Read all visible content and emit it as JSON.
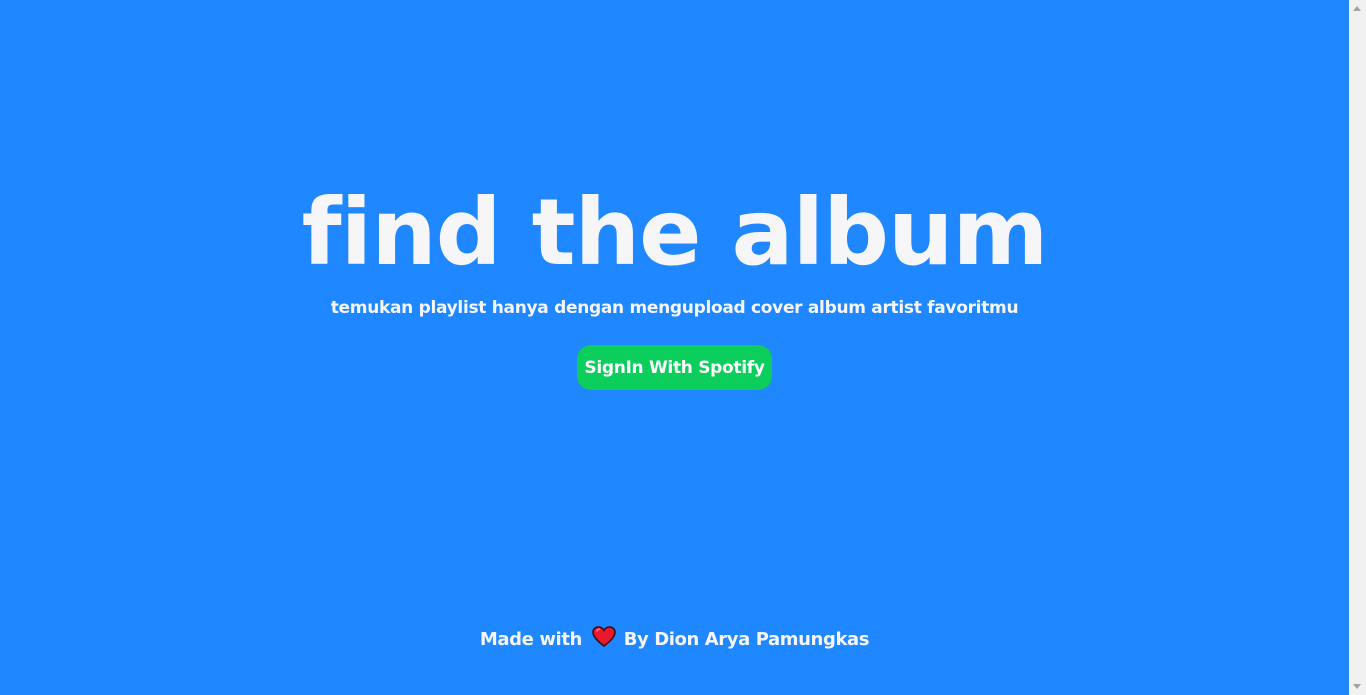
{
  "hero": {
    "title": "find the album",
    "subtitle": "temukan playlist hanya dengan mengupload cover album artist favoritmu"
  },
  "actions": {
    "signin_label": "SignIn With Spotify"
  },
  "footer": {
    "made_with": "Made with",
    "author": "By Dion Arya Pamungkas",
    "heart_icon": "heart-icon"
  },
  "colors": {
    "background": "#1f87ff",
    "button": "#0bce5c",
    "text": "#f6f6f8",
    "heart": "#e8192c"
  }
}
